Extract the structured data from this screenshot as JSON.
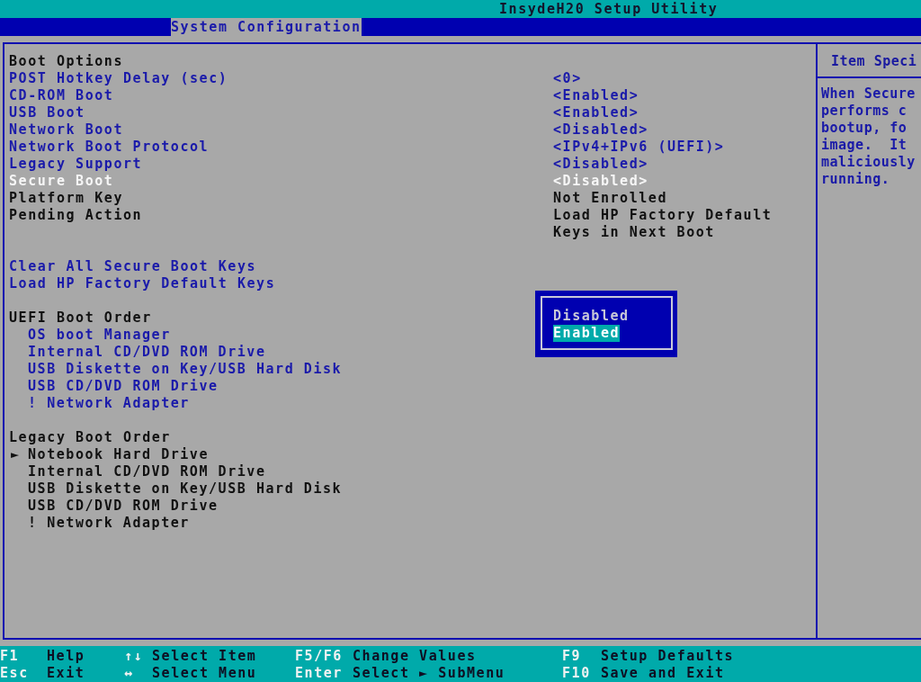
{
  "title": "InsydeH20 Setup Utility",
  "tabs": [
    {
      "label": "System Configuration",
      "selected": true
    }
  ],
  "sections": [
    {
      "heading": "Boot Options",
      "items": [
        {
          "kind": "setting",
          "label": "POST Hotkey Delay (sec)",
          "value": "<0>",
          "selected": false
        },
        {
          "kind": "setting",
          "label": "CD-ROM Boot",
          "value": "<Enabled>",
          "selected": false
        },
        {
          "kind": "setting",
          "label": "USB Boot",
          "value": "<Enabled>",
          "selected": false
        },
        {
          "kind": "setting",
          "label": "Network Boot",
          "value": "<Disabled>",
          "selected": false
        },
        {
          "kind": "setting",
          "label": "Network Boot Protocol",
          "value": "<IPv4+IPv6 (UEFI)>",
          "selected": false
        },
        {
          "kind": "setting",
          "label": "Legacy Support",
          "value": "<Disabled>",
          "selected": false
        },
        {
          "kind": "setting",
          "label": "Secure Boot",
          "value": "<Disabled>",
          "selected": true
        },
        {
          "kind": "info",
          "label": "Platform Key",
          "value": "Not Enrolled",
          "selected": false
        },
        {
          "kind": "info",
          "label": "Pending Action",
          "value": "Load HP Factory Default Keys in Next Boot",
          "selected": false
        }
      ]
    },
    {
      "items": [
        {
          "kind": "action",
          "label": "Clear All Secure Boot Keys",
          "selected": false
        },
        {
          "kind": "action",
          "label": "Load HP Factory Default Keys",
          "selected": false
        }
      ]
    },
    {
      "heading": "UEFI Boot Order",
      "items": [
        {
          "kind": "device",
          "label": "OS boot Manager",
          "disabled": false,
          "selected": false
        },
        {
          "kind": "device",
          "label": "Internal CD/DVD ROM Drive",
          "disabled": false,
          "selected": false
        },
        {
          "kind": "device",
          "label": "USB Diskette on Key/USB Hard Disk",
          "disabled": false,
          "selected": false
        },
        {
          "kind": "device",
          "label": "USB CD/DVD ROM Drive",
          "disabled": false,
          "selected": false
        },
        {
          "kind": "device",
          "label": "! Network Adapter",
          "disabled": false,
          "selected": false
        }
      ]
    },
    {
      "heading": "Legacy Boot Order",
      "items": [
        {
          "kind": "device",
          "label": "Notebook Hard Drive",
          "marker": "►",
          "disabled": true,
          "selected": false
        },
        {
          "kind": "device",
          "label": "Internal CD/DVD ROM Drive",
          "disabled": true,
          "selected": false
        },
        {
          "kind": "device",
          "label": "USB Diskette on Key/USB Hard Disk",
          "disabled": true,
          "selected": false
        },
        {
          "kind": "device",
          "label": "USB CD/DVD ROM Drive",
          "disabled": true,
          "selected": false
        },
        {
          "kind": "device",
          "label": "! Network Adapter",
          "disabled": true,
          "selected": false
        }
      ]
    }
  ],
  "popup": {
    "options": [
      {
        "label": "Disabled",
        "selected": false
      },
      {
        "label": "Enabled",
        "selected": true
      }
    ]
  },
  "help": {
    "title": "Item Speci",
    "lines": [
      "When Secure",
      "performs c",
      "bootup, fo",
      "image.  It",
      "maliciously",
      "running."
    ]
  },
  "key_help": [
    {
      "key": "F1",
      "action": "Help"
    },
    {
      "key": "↑↓",
      "action": "Select Item"
    },
    {
      "key": "F5/F6",
      "action": "Change Values"
    },
    {
      "key": "F9",
      "action": "Setup Defaults"
    },
    {
      "key": "Esc",
      "action": "Exit"
    },
    {
      "key": "↔",
      "action": "Select Menu"
    },
    {
      "key": "Enter",
      "action": "Select ► SubMenu"
    },
    {
      "key": "F10",
      "action": "Save and Exit"
    }
  ]
}
